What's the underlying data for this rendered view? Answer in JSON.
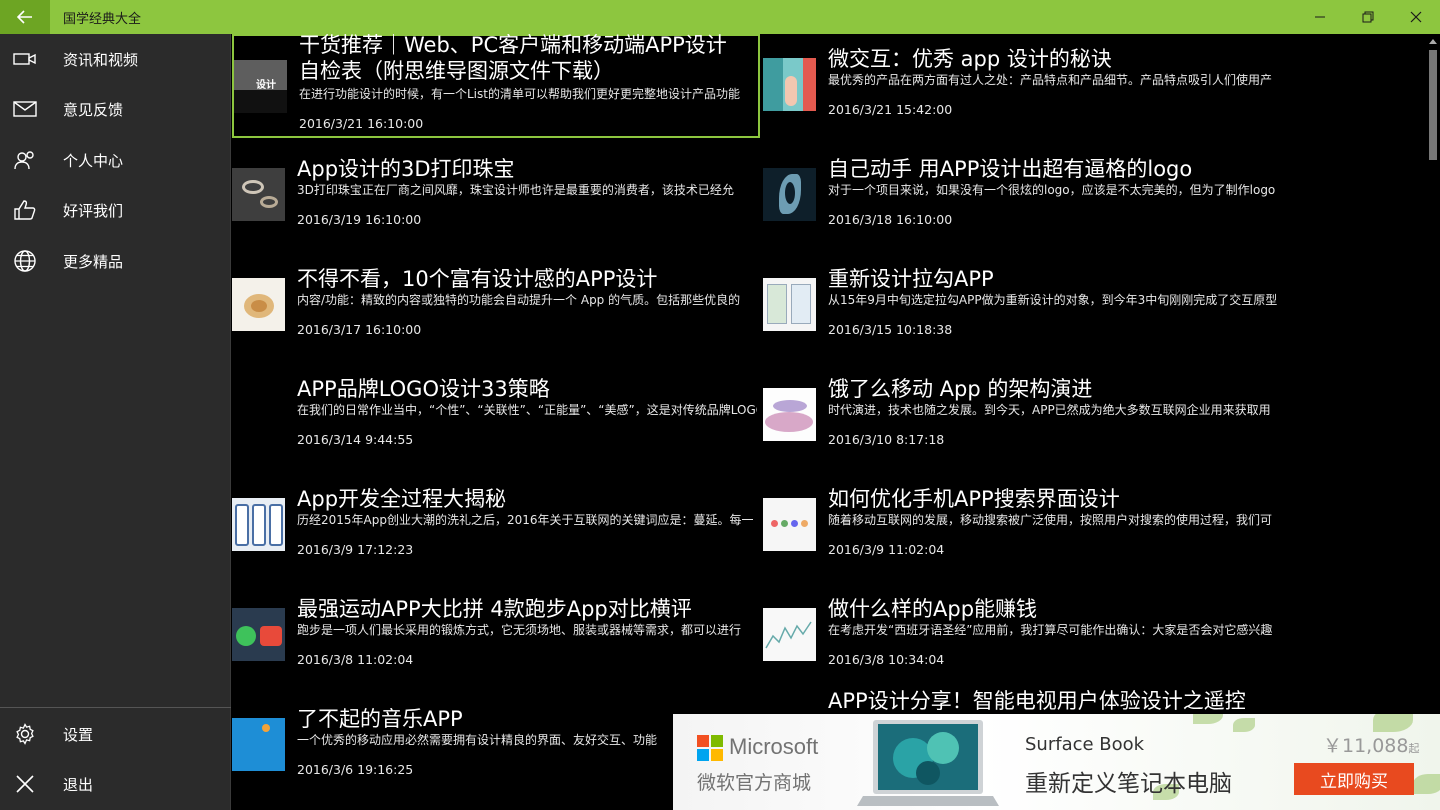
{
  "app": {
    "title": "国学经典大全"
  },
  "colors": {
    "accent": "#8dc63f",
    "sidebar_bg": "#2b2b2b",
    "content_bg": "#000000",
    "buy_button": "#e84a1f"
  },
  "titlebar": {
    "back_icon": "back-arrow-icon",
    "minimize_icon": "minimize-icon",
    "restore_icon": "restore-icon",
    "close_icon": "close-icon"
  },
  "sidebar": {
    "items": [
      {
        "label": "资讯和视频",
        "icon": "video-camera-icon"
      },
      {
        "label": "意见反馈",
        "icon": "mail-icon"
      },
      {
        "label": "个人中心",
        "icon": "people-icon"
      },
      {
        "label": "好评我们",
        "icon": "thumbs-up-icon"
      },
      {
        "label": "更多精品",
        "icon": "globe-icon"
      }
    ],
    "bottom_items": [
      {
        "label": "设置",
        "icon": "gear-icon"
      },
      {
        "label": "退出",
        "icon": "close-icon"
      }
    ]
  },
  "articles": [
    {
      "title": "干货推荐｜Web、PC客户端和移动端APP设计自检表（附思维导图源文件下载）",
      "title_line1": "干货推荐｜Web、PC客户端和移动端APP设计",
      "title_line2": "自检表（附思维导图源文件下载）",
      "summary": "在进行功能设计的时候，有一个List的清单可以帮助我们更好更完整地设计产品功能",
      "date": "2016/3/21 16:10:00",
      "thumb_text": "设计"
    },
    {
      "title": "微交互：优秀 app 设计的秘诀",
      "summary": "最优秀的产品在两方面有过人之处：产品特点和产品细节。产品特点吸引人们使用产",
      "date": "2016/3/21 15:42:00"
    },
    {
      "title": "App设计的3D打印珠宝",
      "summary": "3D打印珠宝正在厂商之间风靡，珠宝设计师也许是最重要的消费者，该技术已经允",
      "date": "2016/3/19 16:10:00"
    },
    {
      "title": "自己动手 用APP设计出超有逼格的logo",
      "summary": "对于一个项目来说，如果没有一个很炫的logo，应该是不太完美的，但为了制作logo",
      "date": "2016/3/18 16:10:00"
    },
    {
      "title": "不得不看，10个富有设计感的APP设计",
      "summary": "内容/功能：精致的内容或独特的功能会自动提升一个 App 的气质。包括那些优良的",
      "date": "2016/3/17 16:10:00"
    },
    {
      "title": "重新设计拉勾APP",
      "summary": "从15年9月中旬选定拉勾APP做为重新设计的对象，到今年3中旬刚刚完成了交互原型",
      "date": "2016/3/15 10:18:38"
    },
    {
      "title": "APP品牌LOGO设计33策略",
      "summary": "在我们的日常作业当中，“个性”、“关联性”、“正能量”、“美感”，这是对传统品牌LOGO",
      "date": "2016/3/14 9:44:55"
    },
    {
      "title": "饿了么移动 App 的架构演进",
      "summary": "时代演进，技术也随之发展。到今天，APP已然成为绝大多数互联网企业用来获取用",
      "date": "2016/3/10 8:17:18"
    },
    {
      "title": "App开发全过程大揭秘",
      "summary": "历经2015年App创业大潮的洗礼之后，2016年关于互联网的关键词应是：蔓延。每一",
      "date": "2016/3/9 17:12:23"
    },
    {
      "title": "如何优化手机APP搜索界面设计",
      "summary": "随着移动互联网的发展，移动搜索被广泛使用，按照用户对搜索的使用过程，我们可",
      "date": "2016/3/9 11:02:04"
    },
    {
      "title": "最强运动APP大比拼 4款跑步App对比横评",
      "summary": "跑步是一项人们最长采用的锻炼方式，它无须场地、服装或器械等需求，都可以进行",
      "date": "2016/3/8 11:02:04"
    },
    {
      "title": "做什么样的App能赚钱",
      "summary": "在考虑开发“西班牙语圣经”应用前，我打算尽可能作出确认：大家是否会对它感兴趣",
      "date": "2016/3/8 10:34:04"
    },
    {
      "title": "了不起的音乐APP",
      "summary": "一个优秀的移动应用必然需要拥有设计精良的界面、友好交互、功能",
      "date": "2016/3/6 19:16:25"
    },
    {
      "title": "APP设计分享！智能电视用户体验设计之遥控",
      "summary": "",
      "date": ""
    }
  ],
  "ad": {
    "brand": "Microsoft",
    "store": "微软官方商城",
    "product": "Surface Book",
    "tagline": "重新定义笔记本电脑",
    "price": "￥11,088",
    "price_suffix": "起",
    "cta": "立即购买"
  }
}
